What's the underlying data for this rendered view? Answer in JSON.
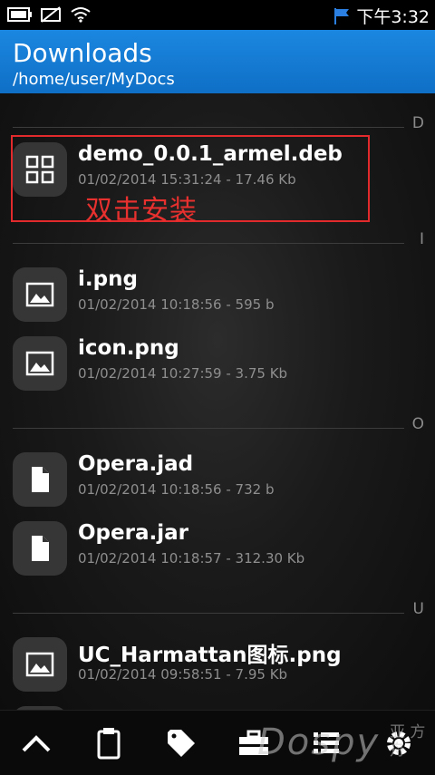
{
  "status_bar": {
    "time": "下午3:32"
  },
  "header": {
    "title": "Downloads",
    "path": "/home/user/MyDocs"
  },
  "sections": [
    {
      "letter": "D"
    },
    {
      "letter": "I"
    },
    {
      "letter": "O"
    },
    {
      "letter": "U"
    }
  ],
  "items": [
    {
      "name": "demo_0.0.1_armel.deb",
      "meta": "01/02/2014 15:31:24 - 17.46 Kb",
      "icon": "apps-grid-icon"
    },
    {
      "name": "i.png",
      "meta": "01/02/2014 10:18:56 - 595 b",
      "icon": "image-icon"
    },
    {
      "name": "icon.png",
      "meta": "01/02/2014 10:27:59 - 3.75 Kb",
      "icon": "image-icon"
    },
    {
      "name": "Opera.jad",
      "meta": "01/02/2014 10:18:56 - 732 b",
      "icon": "document-icon"
    },
    {
      "name": "Opera.jar",
      "meta": "01/02/2014 10:18:57 - 312.30 Kb",
      "icon": "document-icon"
    },
    {
      "name": "UC_Harmattan图标.png",
      "meta": "01/02/2014 09:58:51 - 7.95 Kb",
      "icon": "image-icon"
    }
  ],
  "annotation": {
    "text": "双击安装"
  },
  "toolbar": {
    "items": [
      "up-arrow-icon",
      "clipboard-icon",
      "tag-icon",
      "toolbox-icon",
      "list-icon",
      "settings-icon"
    ]
  },
  "watermark": {
    "text": "Dospy",
    "text2": "亚 方舟"
  },
  "colors": {
    "header": "#1578d2",
    "highlight": "#e2292c",
    "annotation": "#e8312f"
  }
}
